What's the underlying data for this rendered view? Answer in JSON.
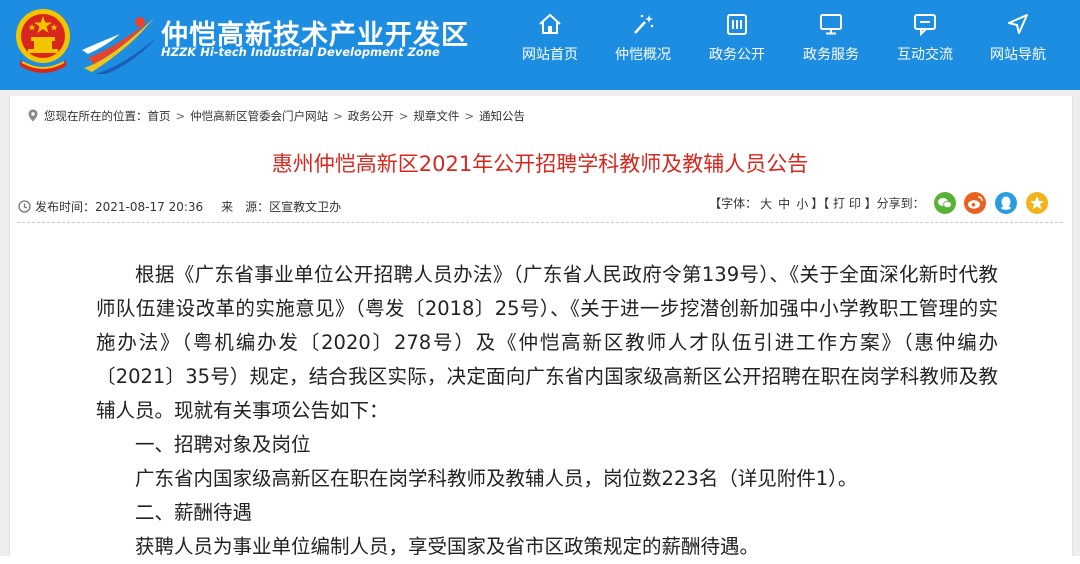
{
  "site": {
    "title": "仲恺高新技术产业开发区",
    "subtitle": "HZZK Hi-tech Industrial Development Zone"
  },
  "nav": [
    {
      "label": "网站首页",
      "icon": "home-icon"
    },
    {
      "label": "仲恺概况",
      "icon": "wand-sparkle-icon"
    },
    {
      "label": "政务公开",
      "icon": "calendar-grid-icon"
    },
    {
      "label": "政务服务",
      "icon": "monitor-icon"
    },
    {
      "label": "互动交流",
      "icon": "chat-bubble-icon"
    },
    {
      "label": "网站导航",
      "icon": "navigation-arrow-icon"
    }
  ],
  "breadcrumb": {
    "prefix": "您现在所在的位置：",
    "items": [
      "首页",
      "仲恺高新区管委会门户网站",
      "政务公开",
      "规章文件",
      "通知公告"
    ],
    "separator": ">"
  },
  "article": {
    "title": "惠州仲恺高新区2021年公开招聘学科教师及教辅人员公告",
    "publish_label": "发布时间：",
    "publish_time": "2021-08-17 20:36",
    "source_label": "来　源：",
    "source": "区宣教文卫办",
    "font_label": "【字体：",
    "font_sizes": [
      "大",
      "中",
      "小"
    ],
    "font_close": "】",
    "print_label": "【 打 印 】",
    "share_label": "分享到：",
    "paragraphs": [
      "根据《广东省事业单位公开招聘人员办法》（广东省人民政府令第139号）、《关于全面深化新时代教师队伍建设改革的实施意见》（粤发〔2018〕25号）、《关于进一步挖潜创新加强中小学教职工管理的实施办法》（粤机编办发〔2020〕278号）及《仲恺高新区教师人才队伍引进工作方案》（惠仲编办〔2021〕35号）规定，结合我区实际，决定面向广东省内国家级高新区公开招聘在职在岗学科教师及教辅人员。现就有关事项公告如下：",
      "一、招聘对象及岗位",
      "广东省内国家级高新区在职在岗学科教师及教辅人员，岗位数223名（详见附件1）。",
      "二、薪酬待遇",
      "获聘人员为事业单位编制人员，享受国家及省市区政策规定的薪酬待遇。"
    ]
  },
  "share_icons": [
    {
      "name": "wechat-icon",
      "color": "#58b238"
    },
    {
      "name": "weibo-icon",
      "color": "#e9601f"
    },
    {
      "name": "qq-icon",
      "color": "#2a9ce0"
    },
    {
      "name": "qzone-icon",
      "color": "#f2b416"
    }
  ],
  "colors": {
    "header_bg": "#1c8de0",
    "title_red": "#d6281e",
    "page_band": "#eeeeee"
  }
}
